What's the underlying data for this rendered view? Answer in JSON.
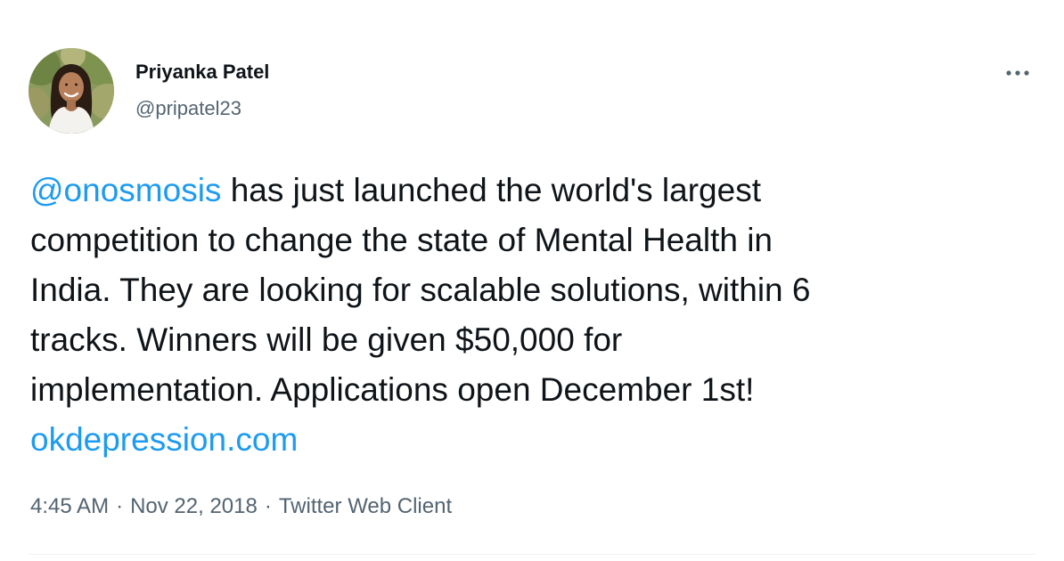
{
  "author": {
    "name": "Priyanka Patel",
    "handle": "@pripatel23"
  },
  "tweet": {
    "mention": "@onosmosis",
    "line1_rest": " has just launched the world's largest",
    "line2": "competition to change the state of Mental Health in",
    "line3": "India. They are looking for scalable solutions, within 6",
    "line4": "tracks. Winners will be given $50,000 for",
    "line5": "implementation. Applications open December 1st!",
    "link": "okdepression.com"
  },
  "meta": {
    "time": "4:45 AM",
    "separator": "·",
    "date": "Nov 22, 2018",
    "client": "Twitter Web Client"
  },
  "icons": {
    "more": "more-horizontal-icon",
    "avatar": "profile-photo"
  },
  "colors": {
    "link": "#1d9bf0",
    "text": "#0f1419",
    "secondary": "#536471",
    "divider": "#eff3f4"
  }
}
